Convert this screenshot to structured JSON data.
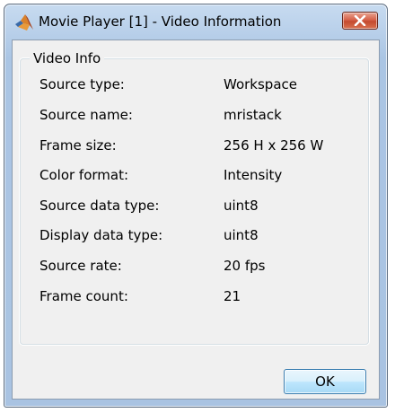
{
  "window": {
    "title": "Movie Player [1] - Video Information",
    "icon": "matlab-logo-icon",
    "close_icon": "close-icon"
  },
  "group": {
    "legend": "Video Info",
    "rows": [
      {
        "label": "Source type:",
        "value": "Workspace"
      },
      {
        "label": "Source name:",
        "value": "mristack"
      },
      {
        "label": "Frame size:",
        "value": "256 H x 256 W"
      },
      {
        "label": "Color format:",
        "value": "Intensity"
      },
      {
        "label": "Source data type:",
        "value": "uint8"
      },
      {
        "label": "Display data type:",
        "value": "uint8"
      },
      {
        "label": "Source rate:",
        "value": "20 fps"
      },
      {
        "label": "Frame count:",
        "value": "21"
      }
    ]
  },
  "buttons": {
    "ok_label": "OK"
  },
  "colors": {
    "close_button": "#c7543a",
    "ok_button_border": "#3c7fb1",
    "title_bar": "#b9d0ea"
  }
}
